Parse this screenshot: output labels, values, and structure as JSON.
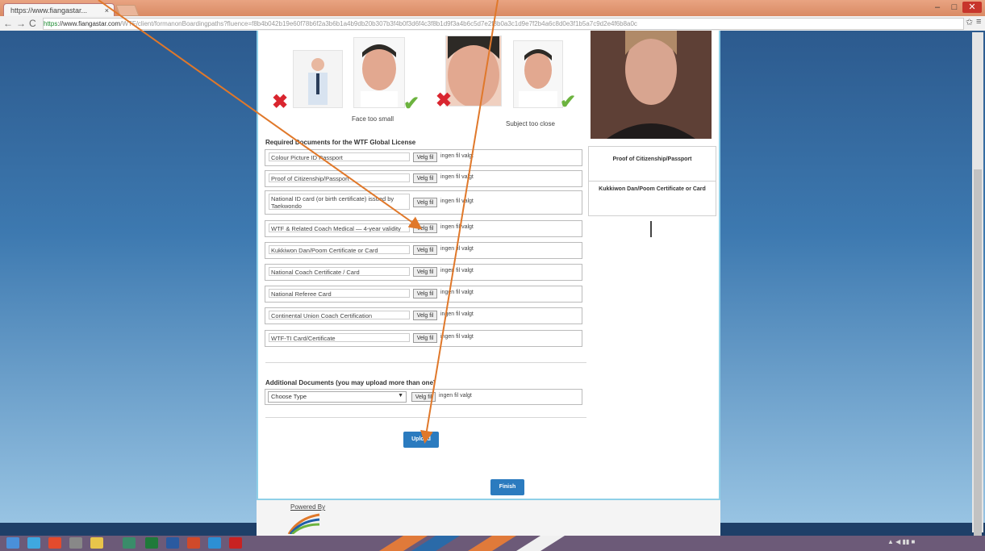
{
  "browser": {
    "tab_title": "https://www.fiangastar...",
    "tab_close": "×",
    "url_secure": "https",
    "url_host": "://www.fiangastar.com",
    "url_path": "/WTF/client/formanonBoardingpaths?fluence=f8b4b042b19e60f78b6f2a3b6b1a4b9db20b307b3f4b0f3d6f4c3f8b1d9f3a4b6c5d7e2f8b0a3c1d9e7f2b4a6c8d0e3f1b5a7c9d2e4f6b8a0c",
    "nav_back": "←",
    "nav_forward": "→",
    "nav_reload": "C",
    "star": "✩",
    "menu": "≡",
    "window_min": "–",
    "window_max": "□",
    "window_close": "✕"
  },
  "samples": {
    "caption_left": "Face too small",
    "caption_right": "Subject too close",
    "x_mark": "✖",
    "check_mark": "✔"
  },
  "right_column": {
    "label_passport": "Proof of Citizenship/Passport",
    "label_dan": "Kukkiwon Dan/Poom Certificate or Card"
  },
  "form": {
    "required_heading": "Required Documents for the WTF Global License",
    "choose_label": "Velg fil",
    "no_file": "ingen fil valgt",
    "documents": [
      "Colour Picture ID Passport",
      "Proof of Citizenship/Passport",
      "National ID card (or birth certificate) issued by Taekwondo",
      "WTF & Related Coach Medical — 4-year validity",
      "Kukkiwon Dan/Poom Certificate or Card",
      "National Coach Certificate / Card",
      "National Referee Card",
      "Continental Union Coach Certification",
      "WTF-TI Card/Certificate"
    ],
    "additional_heading": "Additional Documents (you may upload more than one)",
    "select_value": "Choose Type",
    "select_arrow": "▼",
    "upload_button": "Upload",
    "finish_button": "Finish"
  },
  "footer": {
    "powered_by": "Powered By"
  },
  "colors": {
    "accent_blue": "#2b7bbf",
    "annotation_arrow": "#e0782a",
    "error_red": "#d9252f",
    "ok_green": "#6cb33f"
  }
}
